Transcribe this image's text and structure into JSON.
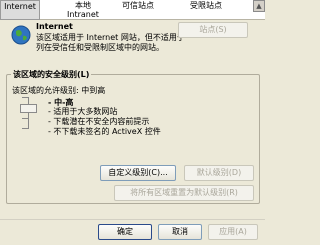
{
  "zones": [
    {
      "label": "Internet",
      "label2": ""
    },
    {
      "label": "本地",
      "label2": "Intranet"
    },
    {
      "label": "可信站点",
      "label2": ""
    },
    {
      "label": "受限站点",
      "label2": ""
    }
  ],
  "zone_info": {
    "title": "Internet",
    "description": "该区域适用于 Internet 网站，但不适用于列在受信任和受限制区域中的网站。",
    "sites_button": "站点(S)"
  },
  "security": {
    "group_title": "该区域的安全级别(L)",
    "allowed_levels": "该区域的允许级别: 中到高",
    "level_name": "- 中-高",
    "level_desc": [
      "- 适用于大多数网站",
      "- 下载潜在不安全内容前提示",
      "- 不下载未签名的 ActiveX 控件"
    ],
    "custom_button": "自定义级别(C)...",
    "default_button": "默认级别(D)",
    "reset_all_button": "将所有区域重置为默认级别(R)"
  },
  "dialog_buttons": {
    "ok": "确定",
    "cancel": "取消",
    "apply": "应用(A)"
  }
}
